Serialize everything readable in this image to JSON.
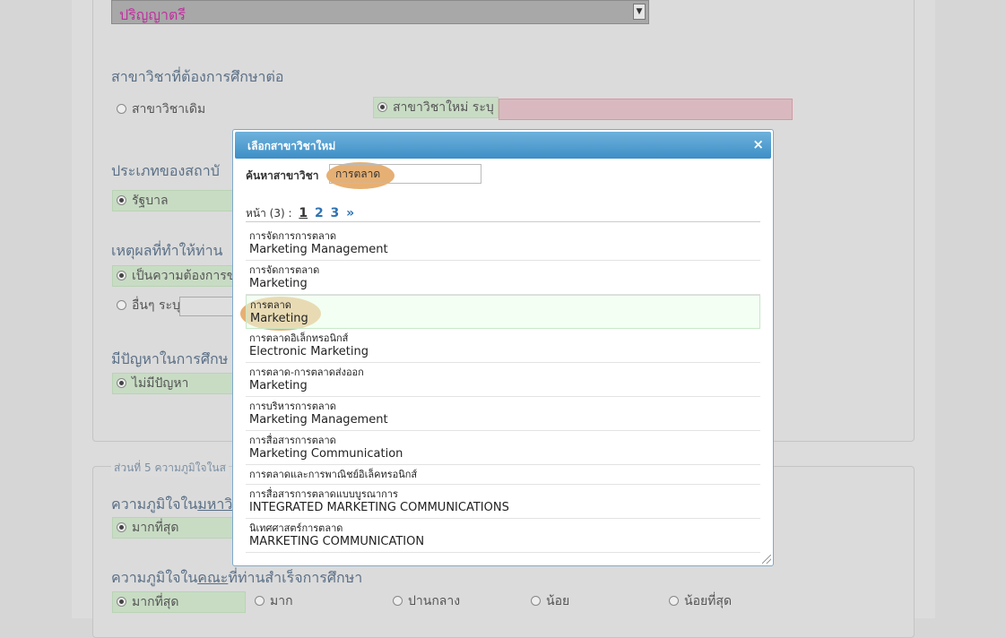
{
  "degree_select": {
    "value": "ปริญญาตรี",
    "arrow": "▼"
  },
  "major": {
    "heading": "สาขาวิชาที่ต้องการศึกษาต่อ",
    "option_old": "สาขาวิชาเดิม",
    "option_new": "สาขาวิชาใหม่ ระบุ"
  },
  "institution": {
    "heading": "ประเภทของสถาบั",
    "option": "รัฐบาล"
  },
  "reason": {
    "heading": "เหตุผลที่ทำให้ท่าน",
    "option_1": "เป็นความต้องการขอ",
    "option_other": "อื่นๆ ระบุ"
  },
  "problem": {
    "heading": "มีปัญหาในการศึกษ",
    "option": "ไม่มีปัญหา"
  },
  "section5": {
    "legend": "ส่วนที่ 5 ความภูมิใจในส",
    "q1_prefix": "ความภูมิใจใน",
    "q1_underlined": "มหาวิ",
    "q1_option": "มากที่สุด",
    "q2_prefix": "ความภูมิใจใน",
    "q2_underlined": "คณะ",
    "q2_suffix": "ที่ท่านสำเร็จการศึกษา",
    "q2_options": [
      "มากที่สุด",
      "มาก",
      "ปานกลาง",
      "น้อย",
      "น้อยที่สุด"
    ]
  },
  "dialog": {
    "title": "เลือกสาขาวิชาใหม่",
    "close": "×",
    "search_label": "ค้นหาสาขาวิชา",
    "search_value": "การตลาด",
    "pager_label": "หน้า (3) :",
    "pages": [
      "1",
      "2",
      "3"
    ],
    "next": "»",
    "items": [
      {
        "th": "การจัดการการตลาด",
        "en": "Marketing Management"
      },
      {
        "th": "การจัดการตลาด",
        "en": "Marketing"
      },
      {
        "th": "การตลาด",
        "en": "Marketing"
      },
      {
        "th": "การตลาดอิเล็กทรอนิกส์",
        "en": "Electronic Marketing"
      },
      {
        "th": "การตลาด-การตลาดส่งออก",
        "en": "Marketing"
      },
      {
        "th": "การบริหารการตลาด",
        "en": "Marketing Management"
      },
      {
        "th": "การสื่อสารการตลาด",
        "en": "Marketing Communication"
      },
      {
        "th": "การตลาดและการพาณิชย์อิเล็คทรอนิกส์",
        "en": ""
      },
      {
        "th": "การสื่อสารการตลาดแบบบูรณาการ",
        "en": "INTEGRATED MARKETING COMMUNICATIONS"
      },
      {
        "th": "นิเทศศาสตร์การตลาด",
        "en": "MARKETING COMMUNICATION"
      }
    ]
  }
}
